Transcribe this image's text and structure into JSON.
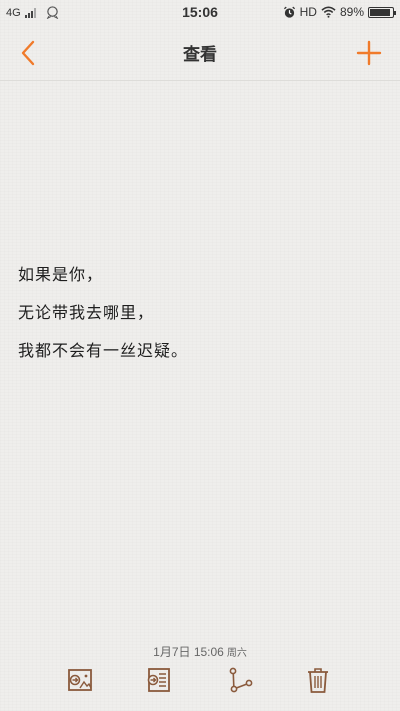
{
  "status_bar": {
    "network": "4G",
    "time": "15:06",
    "hd": "HD",
    "battery": "89%",
    "battery_level": 0.89
  },
  "nav": {
    "title": "查看",
    "back_icon": "chevron-left-icon",
    "add_icon": "plus-icon"
  },
  "note": {
    "lines": [
      "如果是你，",
      "无论带我去哪里，",
      "我都不会有一丝迟疑。"
    ]
  },
  "footer": {
    "date": "1月7日 15:06",
    "weekday": "周六"
  },
  "toolbar": {
    "items": [
      {
        "name": "export-image-icon"
      },
      {
        "name": "export-text-icon"
      },
      {
        "name": "share-icon"
      },
      {
        "name": "trash-icon"
      }
    ]
  },
  "colors": {
    "accent": "#f07a2a",
    "icon_brown": "#8a5a3c",
    "background": "#efeeec"
  }
}
